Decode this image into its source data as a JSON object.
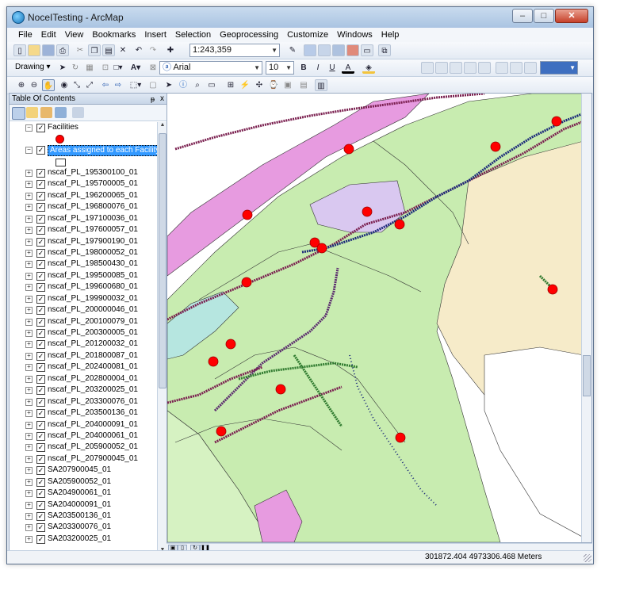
{
  "window": {
    "title": "NoceITesting - ArcMap",
    "buttons": {
      "minimize": "–",
      "maximize": "□",
      "close": "✕"
    }
  },
  "menu": [
    "File",
    "Edit",
    "View",
    "Bookmarks",
    "Insert",
    "Selection",
    "Geoprocessing",
    "Customize",
    "Windows",
    "Help"
  ],
  "standard_toolbar": {
    "scale": "1:243,359"
  },
  "draw_toolbar": {
    "drawing_label": "Drawing ▾",
    "font": "Arial",
    "font_size": "10",
    "bold": "B",
    "italic": "I",
    "underline": "U",
    "text_color_label": "A",
    "fill_label": "A"
  },
  "toc": {
    "title": "Table Of Contents",
    "pin": "ᵽ",
    "close": "x",
    "layers": [
      {
        "name": "Facilities",
        "expand": "−",
        "checked": true,
        "selected": false,
        "symbol": "dot"
      },
      {
        "name": "Areas assigned to each Facility",
        "expand": "−",
        "checked": true,
        "selected": true,
        "symbol": "box"
      },
      {
        "name": "nscaf_PL_195300100_01",
        "expand": "+",
        "checked": true
      },
      {
        "name": "nscaf_PL_195700005_01",
        "expand": "+",
        "checked": true
      },
      {
        "name": "nscaf_PL_196200065_01",
        "expand": "+",
        "checked": true
      },
      {
        "name": "nscaf_PL_196800076_01",
        "expand": "+",
        "checked": true
      },
      {
        "name": "nscaf_PL_197100036_01",
        "expand": "+",
        "checked": true
      },
      {
        "name": "nscaf_PL_197600057_01",
        "expand": "+",
        "checked": true
      },
      {
        "name": "nscaf_PL_197900190_01",
        "expand": "+",
        "checked": true
      },
      {
        "name": "nscaf_PL_198000052_01",
        "expand": "+",
        "checked": true
      },
      {
        "name": "nscaf_PL_198500430_01",
        "expand": "+",
        "checked": true
      },
      {
        "name": "nscaf_PL_199500085_01",
        "expand": "+",
        "checked": true
      },
      {
        "name": "nscaf_PL_199600680_01",
        "expand": "+",
        "checked": true
      },
      {
        "name": "nscaf_PL_199900032_01",
        "expand": "+",
        "checked": true
      },
      {
        "name": "nscaf_PL_200000046_01",
        "expand": "+",
        "checked": true
      },
      {
        "name": "nscaf_PL_200100079_01",
        "expand": "+",
        "checked": true
      },
      {
        "name": "nscaf_PL_200300005_01",
        "expand": "+",
        "checked": true
      },
      {
        "name": "nscaf_PL_201200032_01",
        "expand": "+",
        "checked": true
      },
      {
        "name": "nscaf_PL_201800087_01",
        "expand": "+",
        "checked": true
      },
      {
        "name": "nscaf_PL_202400081_01",
        "expand": "+",
        "checked": true
      },
      {
        "name": "nscaf_PL_202800004_01",
        "expand": "+",
        "checked": true
      },
      {
        "name": "nscaf_PL_203200025_01",
        "expand": "+",
        "checked": true
      },
      {
        "name": "nscaf_PL_203300076_01",
        "expand": "+",
        "checked": true
      },
      {
        "name": "nscaf_PL_203500136_01",
        "expand": "+",
        "checked": true
      },
      {
        "name": "nscaf_PL_204000091_01",
        "expand": "+",
        "checked": true
      },
      {
        "name": "nscaf_PL_204000061_01",
        "expand": "+",
        "checked": true
      },
      {
        "name": "nscaf_PL_205900052_01",
        "expand": "+",
        "checked": true
      },
      {
        "name": "nscaf_PL_207900045_01",
        "expand": "+",
        "checked": true
      },
      {
        "name": "SA207900045_01",
        "expand": "+",
        "checked": true
      },
      {
        "name": "SA205900052_01",
        "expand": "+",
        "checked": true
      },
      {
        "name": "SA204900061_01",
        "expand": "+",
        "checked": true
      },
      {
        "name": "SA204000091_01",
        "expand": "+",
        "checked": true
      },
      {
        "name": "SA203500136_01",
        "expand": "+",
        "checked": true
      },
      {
        "name": "SA203300076_01",
        "expand": "+",
        "checked": true
      },
      {
        "name": "SA203200025_01",
        "expand": "+",
        "checked": true
      }
    ]
  },
  "status": {
    "coordinates": "301872.404  4973306.468 Meters"
  },
  "colors": {
    "facility": "#ff0000",
    "area_green": "#c8ecb0",
    "area_light_green": "#d6f2c2",
    "area_tan": "#f6ebc9",
    "area_lavender": "#d9c8f0",
    "area_pink": "#e79be0",
    "area_teal": "#b6e6e0",
    "route_maroon": "#7a1f4f",
    "route_navy": "#1c2a7a",
    "route_green": "#2f7a2f",
    "route_purple": "#5a2a6e"
  }
}
